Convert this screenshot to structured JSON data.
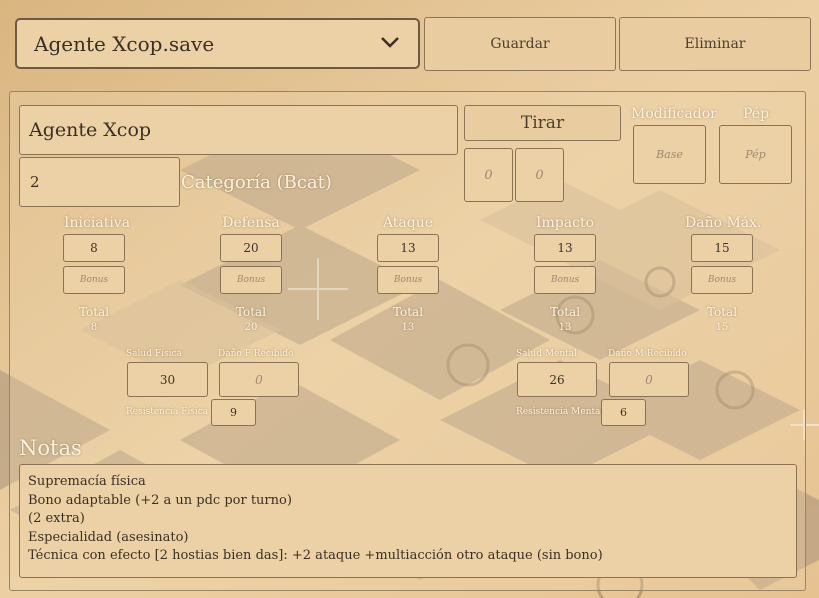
{
  "file_select": {
    "value": "Agente Xcop.save"
  },
  "toolbar": {
    "save_label": "Guardar",
    "delete_label": "Eliminar"
  },
  "character": {
    "name": "Agente Xcop",
    "category_value": "2",
    "category_label": "Categoría (Bcat)"
  },
  "roll": {
    "button_label": "Tirar",
    "die1_placeholder": "0",
    "die2_placeholder": "0",
    "modifier_label": "Modificador",
    "modifier_placeholder": "Base",
    "pep_label": "Pép",
    "pep_placeholder": "Pép"
  },
  "stats": [
    {
      "label": "Iniciativa",
      "value": "8",
      "bonus_placeholder": "Bonus",
      "total_label": "Total",
      "total": "8"
    },
    {
      "label": "Defensa",
      "value": "20",
      "bonus_placeholder": "Bonus",
      "total_label": "Total",
      "total": "20"
    },
    {
      "label": "Ataque",
      "value": "13",
      "bonus_placeholder": "Bonus",
      "total_label": "Total",
      "total": "13"
    },
    {
      "label": "Impacto",
      "value": "13",
      "bonus_placeholder": "Bonus",
      "total_label": "Total",
      "total": "13"
    },
    {
      "label": "Daño Máx.",
      "value": "15",
      "bonus_placeholder": "Bonus",
      "total_label": "Total",
      "total": "15"
    }
  ],
  "health": {
    "physical_label": "Salud Física",
    "physical_value": "30",
    "physical_damage_label": "Daño F Recibido",
    "physical_damage_placeholder": "0",
    "physical_resist_label": "Resistencia Física",
    "physical_resist_value": "9",
    "mental_label": "Salud Mental",
    "mental_value": "26",
    "mental_damage_label": "Daño M Recibido",
    "mental_damage_placeholder": "0",
    "mental_resist_label": "Resistencia Mental",
    "mental_resist_value": "6"
  },
  "notes": {
    "title": "Notas",
    "lines": [
      "Supremacía física",
      "Bono adaptable (+2 a un pdc por turno)",
      "(2 extra)",
      "Especialidad (asesinato)",
      "Técnica con efecto [2 hostias bien das]: +2 ataque +multiacción otro ataque (sin bono)"
    ]
  },
  "colors": {
    "background": "#e9c897",
    "panel": "#ecd1a6",
    "border": "#8a7254",
    "diamond": "#a08a6c",
    "label": "#fff3de"
  }
}
